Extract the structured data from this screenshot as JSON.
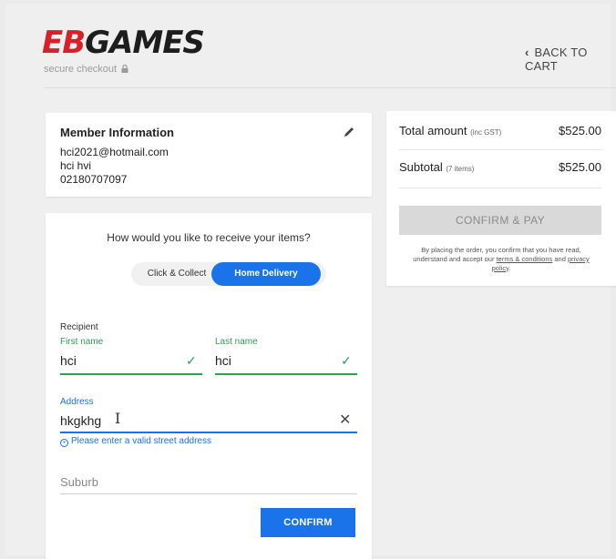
{
  "header": {
    "logo_eb": "EB",
    "logo_games": "GAMES",
    "secure_checkout": "secure checkout",
    "back_to_cart": "BACK TO CART"
  },
  "member": {
    "title": "Member Information",
    "email": "hci2021@hotmail.com",
    "name": "hci hvi",
    "phone": "02180707097"
  },
  "totals": {
    "total_label": "Total amount",
    "total_note": "(inc GST)",
    "total_value": "$525.00",
    "subtotal_label": "Subtotal",
    "subtotal_note": "(7 items)",
    "subtotal_value": "$525.00",
    "confirm_pay": "CONFIRM & PAY",
    "legal_text": "By placing the order, you confirm that you have read, understand and accept our",
    "terms_link": "terms & conditions",
    "and": "and",
    "privacy_link": "privacy policy",
    "period": "."
  },
  "delivery": {
    "question": "How would you like to receive your items?",
    "options": [
      "Click & Collect",
      "Home Delivery"
    ],
    "selected": "Home Delivery"
  },
  "form": {
    "recipient_label": "Recipient",
    "first_name_label": "First name",
    "first_name_value": "hci",
    "last_name_label": "Last name",
    "last_name_value": "hci",
    "address_label": "Address",
    "address_value": "hkgkhg",
    "address_error": "Please enter a valid street address",
    "suburb_placeholder": "Suburb",
    "confirm_button": "CONFIRM"
  },
  "colors": {
    "brand_red": "#d81f2a",
    "accent_blue": "#1a73e8",
    "valid_green": "#2e9e4f"
  }
}
